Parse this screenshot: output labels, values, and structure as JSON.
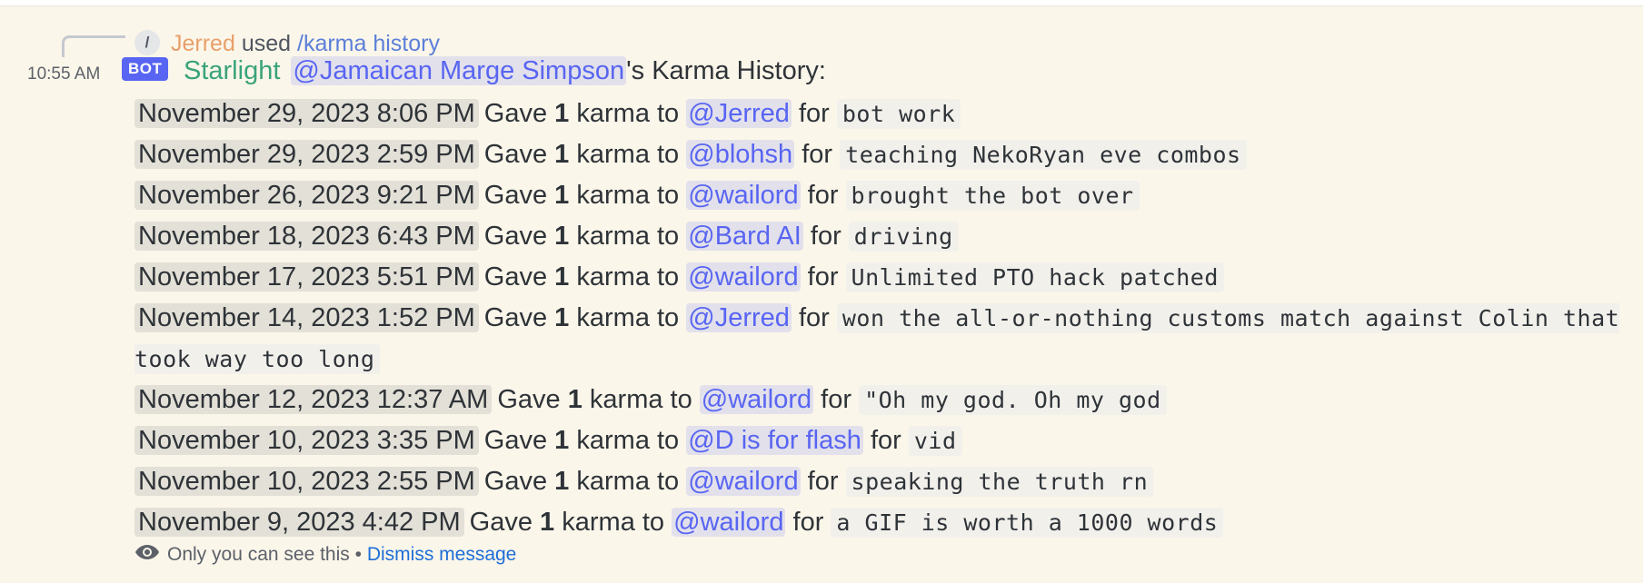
{
  "reply": {
    "user": "Jerred",
    "used": "used",
    "command": "/karma history",
    "slash_glyph": "/"
  },
  "message": {
    "timestamp": "10:55 AM",
    "bot_badge": "BOT",
    "author": "Starlight",
    "target_mention": "@Jamaican Marge Simpson",
    "title_suffix": "'s Karma History:"
  },
  "history": [
    {
      "date": "November 29, 2023 8:06 PM",
      "gave": "Gave",
      "amount": "1",
      "karma_to": "karma to",
      "recipient": "@Jerred",
      "for": "for",
      "reason": "bot work"
    },
    {
      "date": "November 29, 2023 2:59 PM",
      "gave": "Gave",
      "amount": "1",
      "karma_to": "karma to",
      "recipient": "@blohsh",
      "for": "for",
      "reason": "teaching NekoRyan eve combos"
    },
    {
      "date": "November 26, 2023 9:21 PM",
      "gave": "Gave",
      "amount": "1",
      "karma_to": "karma to",
      "recipient": "@wailord",
      "for": "for",
      "reason": "brought the bot over"
    },
    {
      "date": "November 18, 2023 6:43 PM",
      "gave": "Gave",
      "amount": "1",
      "karma_to": "karma to",
      "recipient": "@Bard AI",
      "for": "for",
      "reason": "driving"
    },
    {
      "date": "November 17, 2023 5:51 PM",
      "gave": "Gave",
      "amount": "1",
      "karma_to": "karma to",
      "recipient": "@wailord",
      "for": "for",
      "reason": "Unlimited PTO hack patched"
    },
    {
      "date": "November 14, 2023 1:52 PM",
      "gave": "Gave",
      "amount": "1",
      "karma_to": "karma to",
      "recipient": "@Jerred",
      "for": "for",
      "reason": "won the all-or-nothing customs match against Colin that took way too long"
    },
    {
      "date": "November 12, 2023 12:37 AM",
      "gave": "Gave",
      "amount": "1",
      "karma_to": "karma to",
      "recipient": "@wailord",
      "for": "for",
      "reason": "\"Oh my god. Oh my god"
    },
    {
      "date": "November 10, 2023 3:35 PM",
      "gave": "Gave",
      "amount": "1",
      "karma_to": "karma to",
      "recipient": "@D is for flash",
      "for": "for",
      "reason": "vid"
    },
    {
      "date": "November 10, 2023 2:55 PM",
      "gave": "Gave",
      "amount": "1",
      "karma_to": "karma to",
      "recipient": "@wailord",
      "for": "for",
      "reason": "speaking the truth rn"
    },
    {
      "date": "November 9, 2023 4:42 PM",
      "gave": "Gave",
      "amount": "1",
      "karma_to": "karma to",
      "recipient": "@wailord",
      "for": "for",
      "reason": "a GIF is worth a 1000 words"
    }
  ],
  "footer": {
    "visibility": "Only you can see this",
    "separator": "•",
    "dismiss": "Dismiss message"
  },
  "colors": {
    "background": "#fbf6ea",
    "mention": "#5865f2",
    "author": "#3aa37a",
    "reply_user": "#e8a06a",
    "link": "#1e6ed8"
  },
  "icons": {
    "reply_command": "slash-command-icon",
    "visibility": "eye-icon"
  }
}
